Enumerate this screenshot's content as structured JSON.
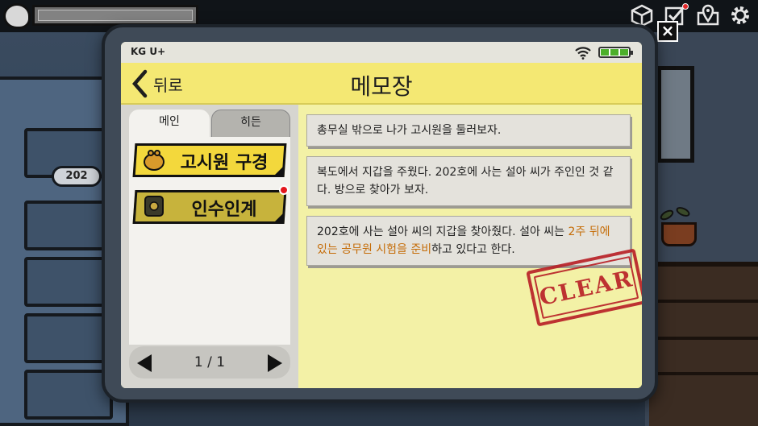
{
  "door": {
    "room_number": "202"
  },
  "tablet": {
    "status": {
      "carrier": "KG U+"
    },
    "header": {
      "back_label": "뒤로",
      "title": "메모장"
    },
    "tabs": [
      {
        "label": "메인"
      },
      {
        "label": "히든"
      }
    ],
    "quests": [
      {
        "label": "고시원 구경",
        "icon": "coin-purse-icon",
        "new": false
      },
      {
        "label": "인수인계",
        "icon": "document-icon",
        "new": true
      }
    ],
    "pager": {
      "text": "1 / 1"
    },
    "notes": [
      {
        "text": "총무실 밖으로 나가 고시원을 둘러보자."
      },
      {
        "text": "복도에서 지갑을 주웠다. 202호에 사는 설아 씨가 주인인 것 같다. 방으로 찾아가 보자."
      },
      {
        "text_before": "202호에 사는 설아 씨의 지갑을 찾아줬다. 설아 씨는 ",
        "highlight": "2주 뒤에 있는 공무원 시험을 준비",
        "text_after": "하고 있다고 한다."
      }
    ],
    "stamp": {
      "text": "CLEAR"
    }
  },
  "colors": {
    "header_yellow": "#f4e873",
    "highlight_orange": "#c56c07",
    "stamp_red": "#b81e25",
    "quest_yellow": "#f3d83c",
    "new_dot_red": "#e4161d"
  }
}
